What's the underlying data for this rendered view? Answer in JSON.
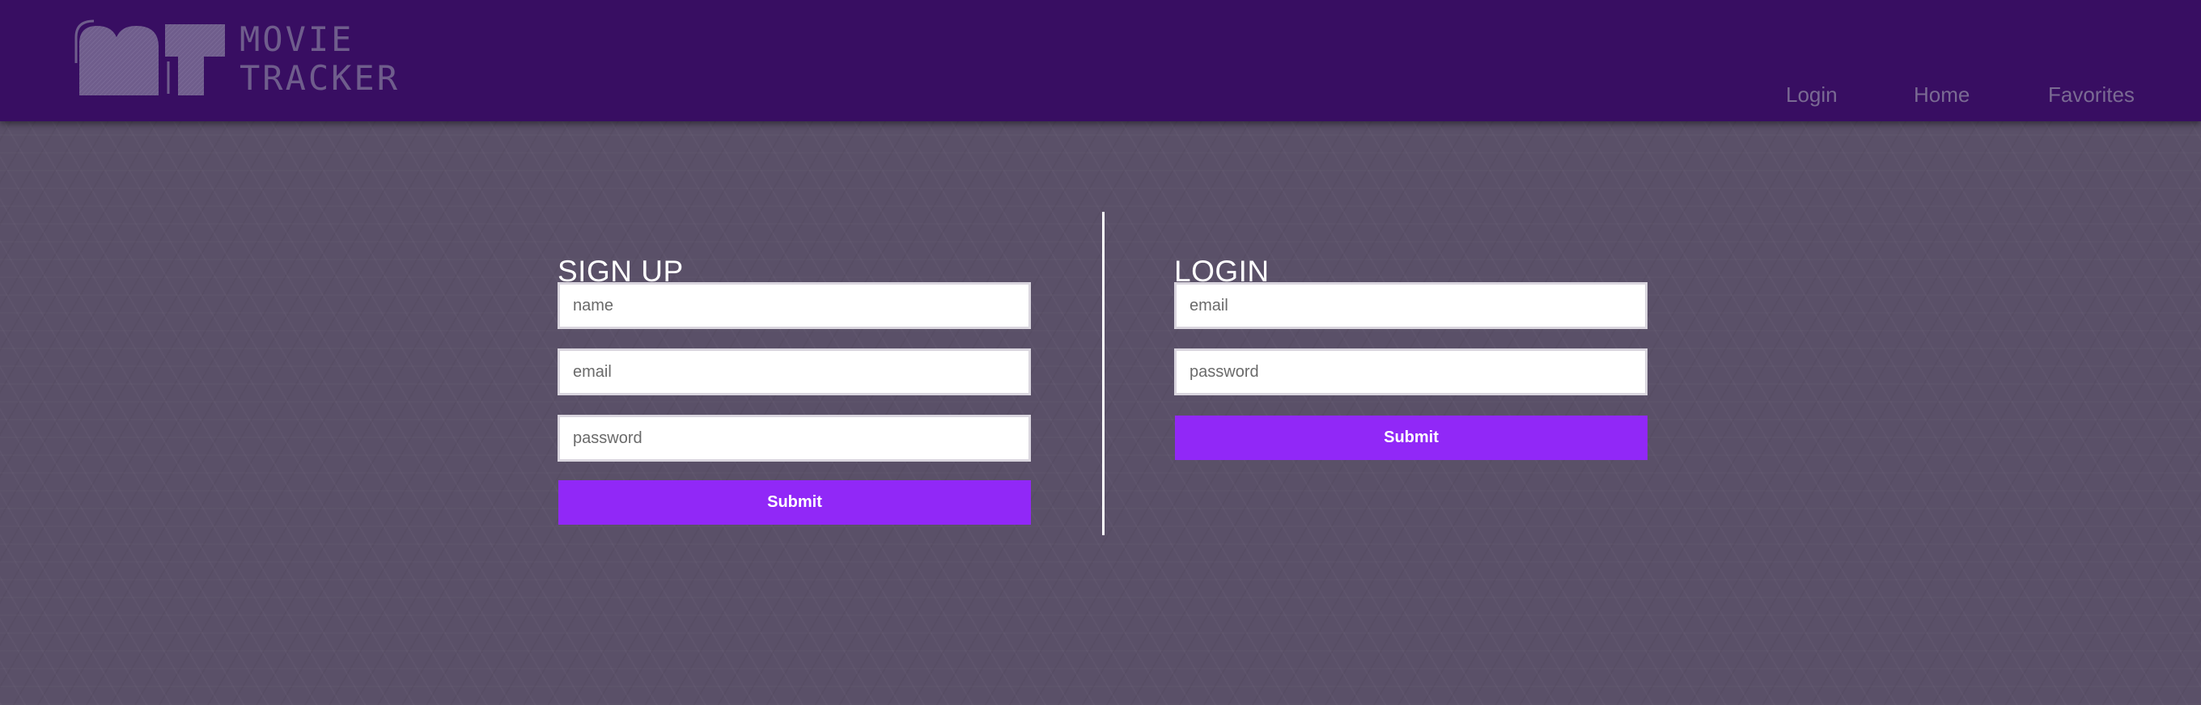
{
  "header": {
    "logo": {
      "line1": "MOVIE",
      "line2": "TRACKER",
      "icon": "film-reel-logo-icon",
      "color": "#6f5d8c"
    },
    "nav": {
      "login": "Login",
      "home": "Home",
      "favorites": "Favorites"
    },
    "background_color": "#380e62"
  },
  "signup": {
    "title": "SIGN UP",
    "name_placeholder": "name",
    "email_placeholder": "email",
    "password_placeholder": "password",
    "submit_label": "Submit"
  },
  "login": {
    "title": "LOGIN",
    "email_placeholder": "email",
    "password_placeholder": "password",
    "submit_label": "Submit"
  },
  "colors": {
    "accent": "#9128f7",
    "page_background": "#5a5068",
    "divider": "#ffffff"
  }
}
